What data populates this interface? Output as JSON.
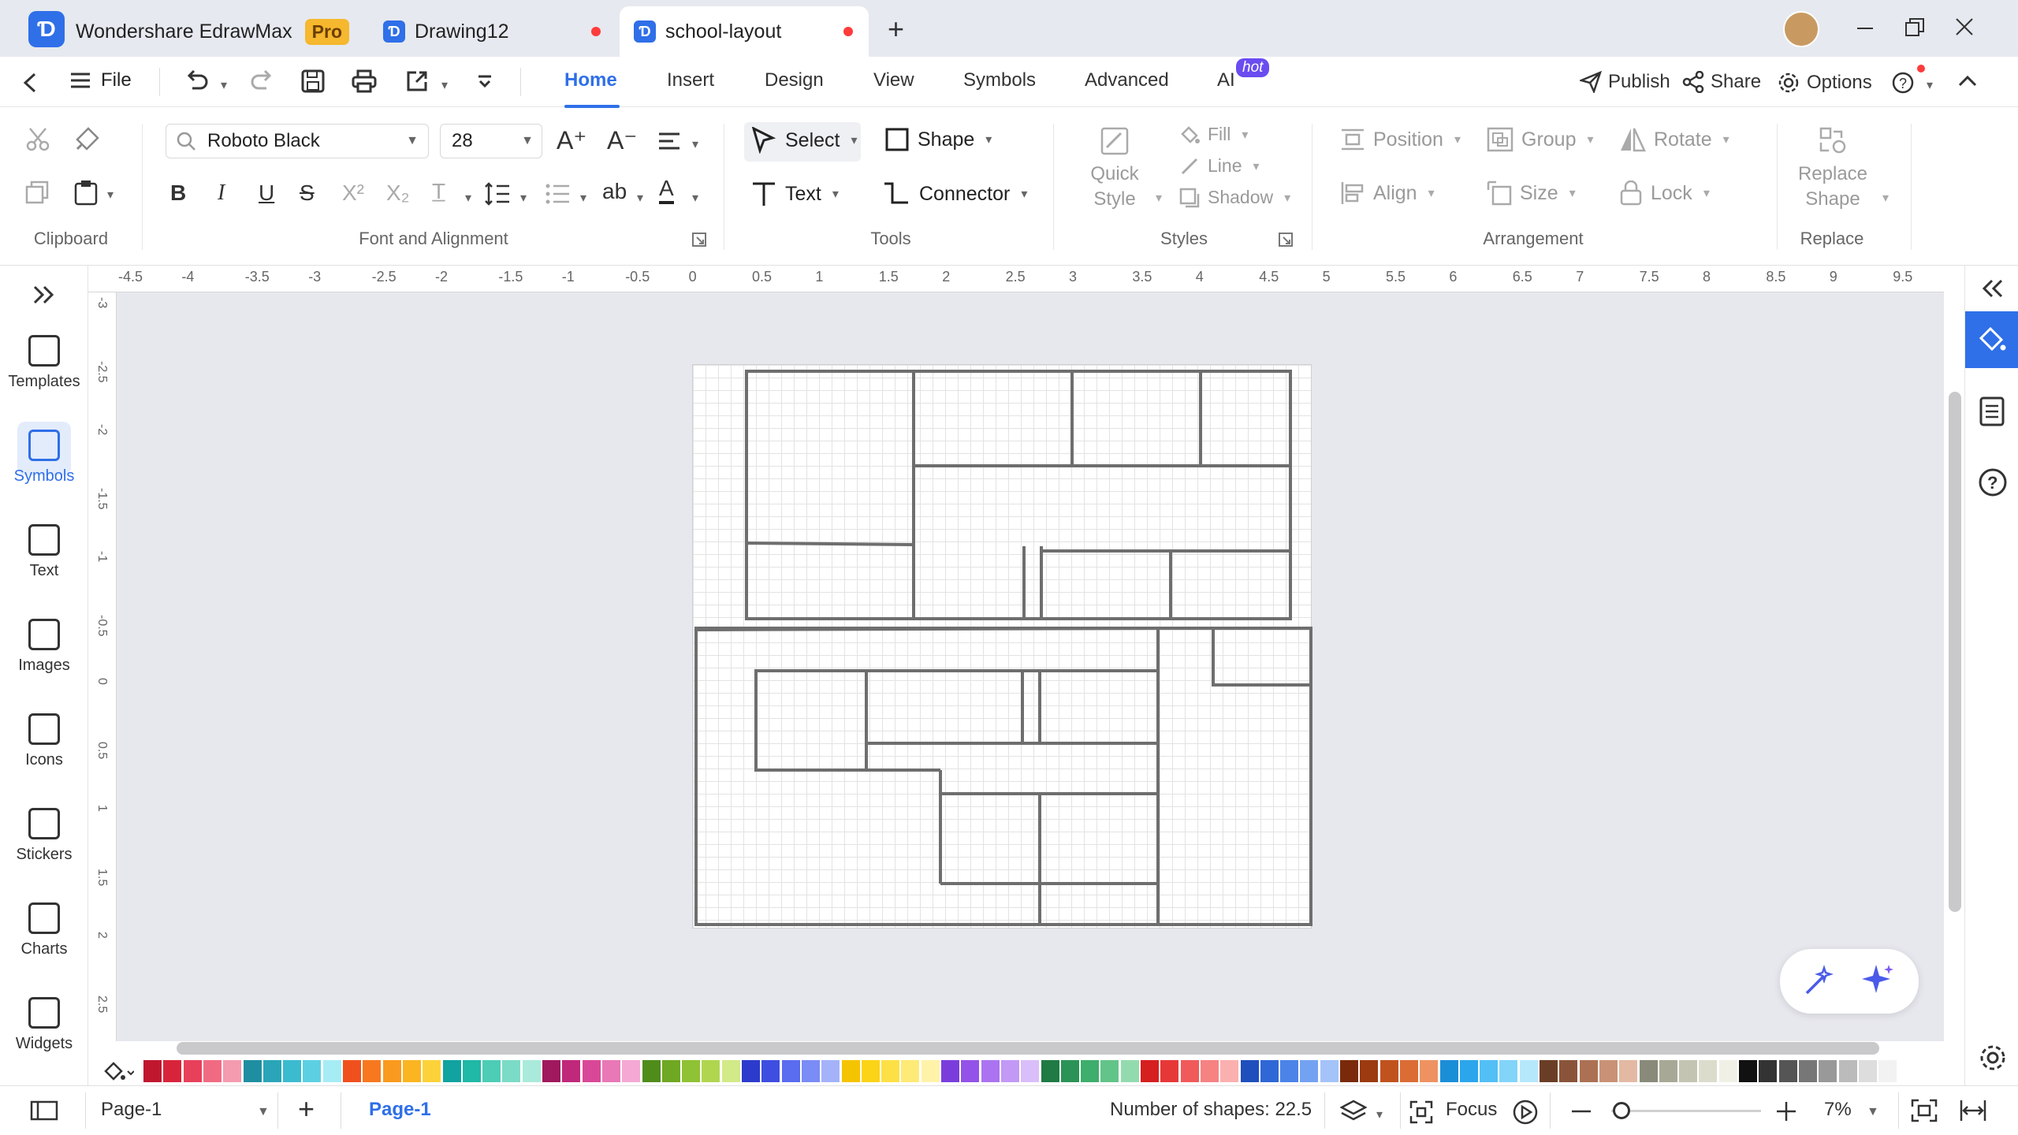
{
  "titlebar": {
    "app_name": "Wondershare EdrawMax",
    "badge": "Pro",
    "tabs": [
      {
        "label": "Drawing12",
        "unsaved": true
      },
      {
        "label": "school-layout",
        "unsaved": true,
        "active": true
      }
    ],
    "new_tab": "+",
    "window_controls": [
      "minimize-icon",
      "restore-icon",
      "close-icon"
    ]
  },
  "menubar": {
    "file_label": "File",
    "tabs": [
      "Home",
      "Insert",
      "Design",
      "View",
      "Symbols",
      "Advanced",
      "AI"
    ],
    "active_tab": "Home",
    "ai_badge": "hot",
    "publish_label": "Publish",
    "share_label": "Share",
    "options_label": "Options"
  },
  "ribbon": {
    "font_family": "Roboto Black",
    "font_size": "28",
    "select_label": "Select",
    "shape_label": "Shape",
    "text_label": "Text",
    "connector_label": "Connector",
    "quick_style_label": "Quick\nStyle",
    "fill_label": "Fill",
    "line_label": "Line",
    "shadow_label": "Shadow",
    "position_label": "Position",
    "group_label": "Group",
    "rotate_label": "Rotate",
    "align_label": "Align",
    "size_label": "Size",
    "lock_label": "Lock",
    "replace_shape_label": "Replace\nShape",
    "groups": {
      "clipboard": "Clipboard",
      "font": "Font and Alignment",
      "tools": "Tools",
      "styles": "Styles",
      "arrangement": "Arrangement",
      "replace": "Replace"
    }
  },
  "leftbar": {
    "items": [
      {
        "label": "Templates",
        "icon": "templates-icon"
      },
      {
        "label": "Symbols",
        "icon": "symbols-icon",
        "active": true
      },
      {
        "label": "Text",
        "icon": "text-icon"
      },
      {
        "label": "Images",
        "icon": "images-icon"
      },
      {
        "label": "Icons",
        "icon": "icons-icon"
      },
      {
        "label": "Stickers",
        "icon": "stickers-icon"
      },
      {
        "label": "Charts",
        "icon": "charts-icon"
      },
      {
        "label": "Widgets",
        "icon": "widgets-icon"
      }
    ]
  },
  "ruler": {
    "top": [
      "-4.5",
      "-4",
      "-3.5",
      "-3",
      "-2.5",
      "-2",
      "-1.5",
      "-1",
      "-0.5",
      "0",
      "0.5",
      "1",
      "1.5",
      "2",
      "2.5",
      "3",
      "3.5",
      "4",
      "4.5",
      "5",
      "5.5",
      "6",
      "6.5",
      "7",
      "7.5",
      "8",
      "8.5",
      "9",
      "9.5"
    ],
    "left": [
      "-3",
      "-2.5",
      "-2",
      "-1.5",
      "-1",
      "-0.5",
      "0",
      "0.5",
      "1",
      "1.5",
      "2",
      "2.5"
    ]
  },
  "palette": [
    "#c0172f",
    "#d8243a",
    "#e8405a",
    "#f06b82",
    "#f59bb0",
    "#1f8ea0",
    "#2aa5b8",
    "#3bbbd0",
    "#5cd0e2",
    "#a6ecf5",
    "#f0501e",
    "#f7781f",
    "#fa9a1e",
    "#fbb521",
    "#fcd23a",
    "#10a3a0",
    "#20b8a6",
    "#4dcdb6",
    "#7adcc6",
    "#aaeadb",
    "#a0185d",
    "#c0287a",
    "#d94898",
    "#e878b6",
    "#f5a8d4",
    "#4f8c1a",
    "#6fa822",
    "#8fc234",
    "#b0d650",
    "#d2ea88",
    "#2c3bcc",
    "#3e4ee0",
    "#5a6cef",
    "#7a8cf5",
    "#a4b2fa",
    "#f5c400",
    "#fbd317",
    "#fde046",
    "#feea77",
    "#fff3aa",
    "#7a3ddc",
    "#9353e8",
    "#ab73f0",
    "#c399f6",
    "#dabef9",
    "#1f7a44",
    "#2b9356",
    "#3eae6c",
    "#62c488",
    "#93dbae",
    "#d61f1f",
    "#e73838",
    "#f05a5a",
    "#f68282",
    "#fbb0b0",
    "#1f4fbd",
    "#2f67d6",
    "#4b83e8",
    "#74a2f2",
    "#a4c3f8",
    "#7a2a0a",
    "#9c3a10",
    "#c0521e",
    "#dc6c36",
    "#ef9262",
    "#1b8ed8",
    "#2ba6ec",
    "#52bff5",
    "#82d4f9",
    "#b6e8fc",
    "#6a3e26",
    "#8a543a",
    "#ac7154",
    "#c99276",
    "#e3b9a4",
    "#8a8a7a",
    "#a8a896",
    "#c4c4b2",
    "#dcdccc",
    "#f0f0e6",
    "#111111",
    "#333333",
    "#555555",
    "#777777",
    "#999999",
    "#bbbbbb",
    "#dddddd",
    "#f2f2f2"
  ],
  "statusbar": {
    "page_dropdown": "Page-1",
    "active_page": "Page-1",
    "add_page": "+",
    "shape_count": "Number of shapes: 22.5",
    "focus_label": "Focus",
    "zoom_value": "7%",
    "zoom_fraction": 0.05
  }
}
